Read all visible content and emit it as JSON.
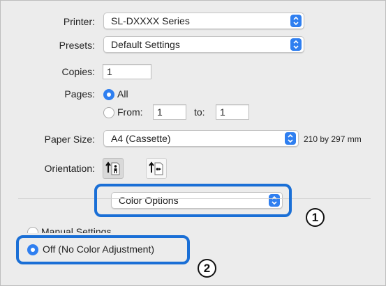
{
  "printer": {
    "label": "Printer:",
    "value": "SL-DXXXX Series"
  },
  "presets": {
    "label": "Presets:",
    "value": "Default Settings"
  },
  "copies": {
    "label": "Copies:",
    "value": "1"
  },
  "pages": {
    "label": "Pages:",
    "all_label": "All",
    "all_selected": true,
    "from_label": "From:",
    "from_value": "1",
    "to_label": "to:",
    "to_value": "1"
  },
  "paper_size": {
    "label": "Paper Size:",
    "value": "A4 (Cassette)",
    "dimensions": "210 by 297 mm"
  },
  "orientation": {
    "label": "Orientation:",
    "options": [
      "portrait-icon",
      "landscape-icon"
    ],
    "selected": "portrait-icon"
  },
  "section_menu": {
    "value": "Color Options"
  },
  "color_mode": {
    "manual_label": "Manual Settings",
    "off_label": "Off (No Color Adjustment)",
    "selected": "off"
  },
  "callouts": {
    "first": "1",
    "second": "2"
  },
  "colors": {
    "accent": "#2f7ff0",
    "highlight": "#1a6fd6",
    "background": "#ececec"
  }
}
